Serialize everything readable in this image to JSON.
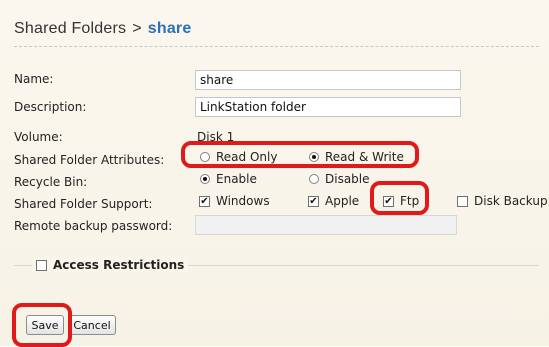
{
  "header": {
    "breadcrumb_root": "Shared Folders",
    "separator": ">",
    "current": "share"
  },
  "form": {
    "name": {
      "label": "Name:",
      "value": "share"
    },
    "description": {
      "label": "Description:",
      "value": "LinkStation folder"
    },
    "volume": {
      "label": "Volume:",
      "value": "Disk 1"
    },
    "attributes": {
      "label": "Shared Folder Attributes:",
      "options": [
        "Read Only",
        "Read & Write"
      ],
      "selected": "Read & Write"
    },
    "recycle_bin": {
      "label": "Recycle Bin:",
      "options": [
        "Enable",
        "Disable"
      ],
      "selected": "Enable"
    },
    "support": {
      "label": "Shared Folder Support:",
      "options": [
        {
          "label": "Windows",
          "checked": true
        },
        {
          "label": "Apple",
          "checked": true
        },
        {
          "label": "Ftp",
          "checked": true
        },
        {
          "label": "Disk Backup",
          "checked": false
        }
      ]
    },
    "remote_backup_password": {
      "label": "Remote backup password:",
      "value": ""
    }
  },
  "access_restrictions": {
    "label": "Access Restrictions",
    "checked": false
  },
  "buttons": {
    "save": "Save",
    "cancel": "Cancel"
  },
  "colors": {
    "highlight": "#e01a1a",
    "link": "#2a72b8"
  }
}
